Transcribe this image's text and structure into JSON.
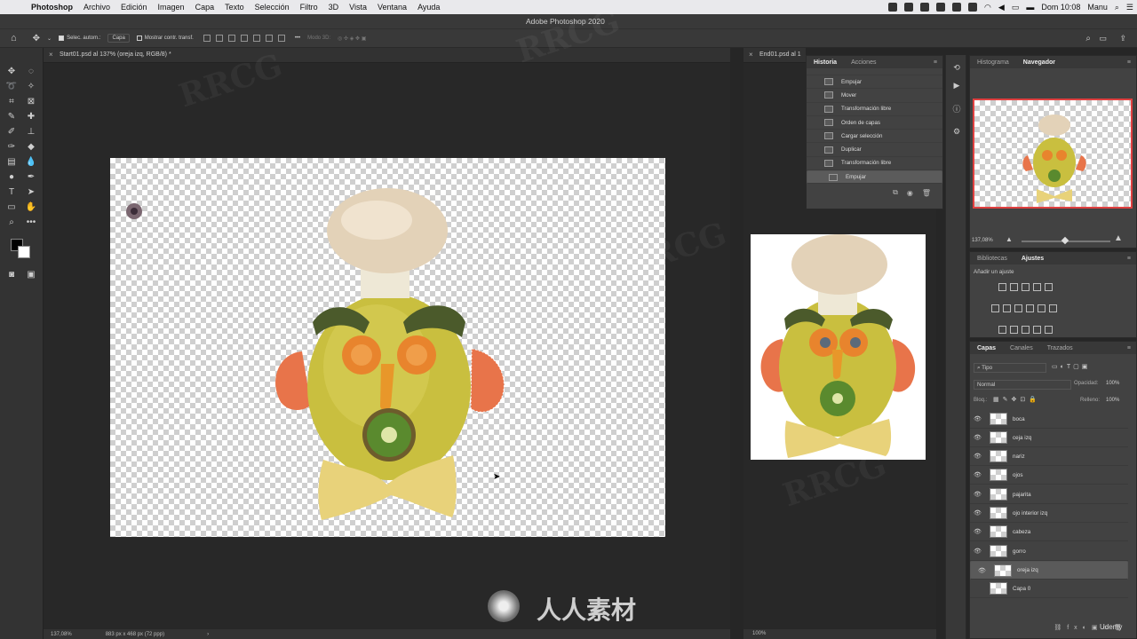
{
  "menubar": {
    "app": "Photoshop",
    "items": [
      "Archivo",
      "Edición",
      "Imagen",
      "Capa",
      "Texto",
      "Selección",
      "Filtro",
      "3D",
      "Vista",
      "Ventana",
      "Ayuda"
    ],
    "window_title": "Adobe Photoshop 2020",
    "clock": "Dom 10:08",
    "user": "Manu"
  },
  "options": {
    "auto_select": "Selec. autom.:",
    "layer_select": "Capa",
    "transform": "Mostrar contr. transf.",
    "mode_3d": "Modo 3D:"
  },
  "documents": {
    "tab1": "Start01.psd al 137% (oreja izq, RGB/8) *",
    "tab2": "End01.psd al 1",
    "zoom1": "137,08%",
    "size1": "883 px x 468 px (72 ppp)",
    "zoom2": "100%"
  },
  "history": {
    "tabs": [
      "Historia",
      "Acciones"
    ],
    "items": [
      "Empujar",
      "Mover",
      "Transformación libre",
      "Orden de capas",
      "Cargar selección",
      "Duplicar",
      "Transformación libre",
      "Empujar"
    ],
    "selected_index": 7
  },
  "navigator": {
    "tabs": [
      "Histograma",
      "Navegador"
    ],
    "zoom": "137,08%"
  },
  "adjust": {
    "tabs": [
      "Bibliotecas",
      "Ajustes"
    ],
    "hint": "Añadir un ajuste"
  },
  "layers": {
    "tabs": [
      "Capas",
      "Canales",
      "Trazados"
    ],
    "filter": "Tipo",
    "blend": "Normal",
    "opacity_label": "Opacidad:",
    "opacity": "100%",
    "lock_label": "Bloq.:",
    "fill_label": "Relleno:",
    "fill": "100%",
    "items": [
      "boca",
      "ceja izq",
      "nariz",
      "ojos",
      "pajarita",
      "ojo interior izq",
      "cabeza",
      "gorro",
      "oreja izq",
      "Capa 0"
    ],
    "selected_index": 8
  },
  "watermark": "RRCG",
  "brand": "人人素材",
  "udemy": "Udemy"
}
